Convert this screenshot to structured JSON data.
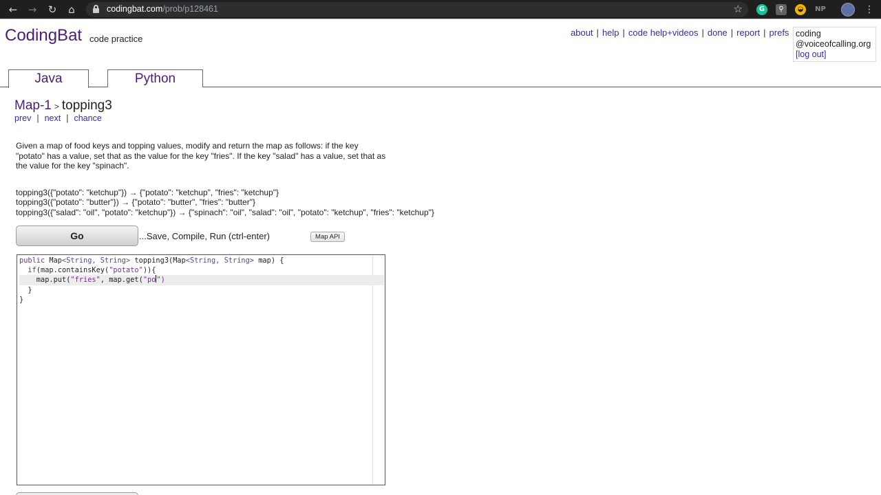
{
  "browser": {
    "url_host": "codingbat.com",
    "url_path": "/prob/p128461",
    "extensions": [
      "grammarly-icon",
      "extension-icon",
      "sunglasses-icon",
      "np-icon",
      "profile-avatar"
    ],
    "np_label": "NP"
  },
  "header": {
    "logo": "CodingBat",
    "tagline": "code practice",
    "links": [
      "about",
      "help",
      "code help+videos",
      "done",
      "report",
      "prefs"
    ],
    "user_line1": "coding",
    "user_line2": "@voiceofcalling.org",
    "logout": "[log out]"
  },
  "tabs": [
    {
      "label": "Java",
      "active": true
    },
    {
      "label": "Python",
      "active": false
    }
  ],
  "problem": {
    "category": "Map-1",
    "arrow": ">",
    "name": "topping3",
    "nav": {
      "prev": "prev",
      "next": "next",
      "chance": "chance"
    },
    "description": "Given a map of food keys and topping values, modify and return the map as follows: if the key \"potato\" has a value, set that as the value for the key \"fries\". If the key \"salad\" has a value, set that as the value for the key \"spinach\".",
    "examples": [
      "topping3({\"potato\": \"ketchup\"}) → {\"potato\": \"ketchup\", \"fries\": \"ketchup\"}",
      "topping3({\"potato\": \"butter\"}) → {\"potato\": \"butter\", \"fries\": \"butter\"}",
      "topping3({\"salad\": \"oil\", \"potato\": \"ketchup\"}) → {\"spinach\": \"oil\", \"salad\": \"oil\", \"potato\": \"ketchup\", \"fries\": \"ketchup\"}"
    ]
  },
  "actions": {
    "go_label": "Go",
    "go_hint": "...Save, Compile, Run (ctrl-enter)",
    "map_api": "Map API"
  },
  "editor": {
    "line1_a": "public",
    "line1_b": " Map",
    "line1_c": "<String, String>",
    "line1_d": " topping3(Map",
    "line1_e": "<String, String>",
    "line1_f": " map) {",
    "line2_a": "  if",
    "line2_b": "(map.containsKey(",
    "line2_c": "\"potato\"",
    "line2_d": ")){",
    "line3_a": "    map.put(",
    "line3_b": "\"fries\"",
    "line3_c": ", map.get(",
    "line3_d": "\"po",
    "line3_e": "\")",
    "line4": "  }",
    "line5": "}"
  }
}
